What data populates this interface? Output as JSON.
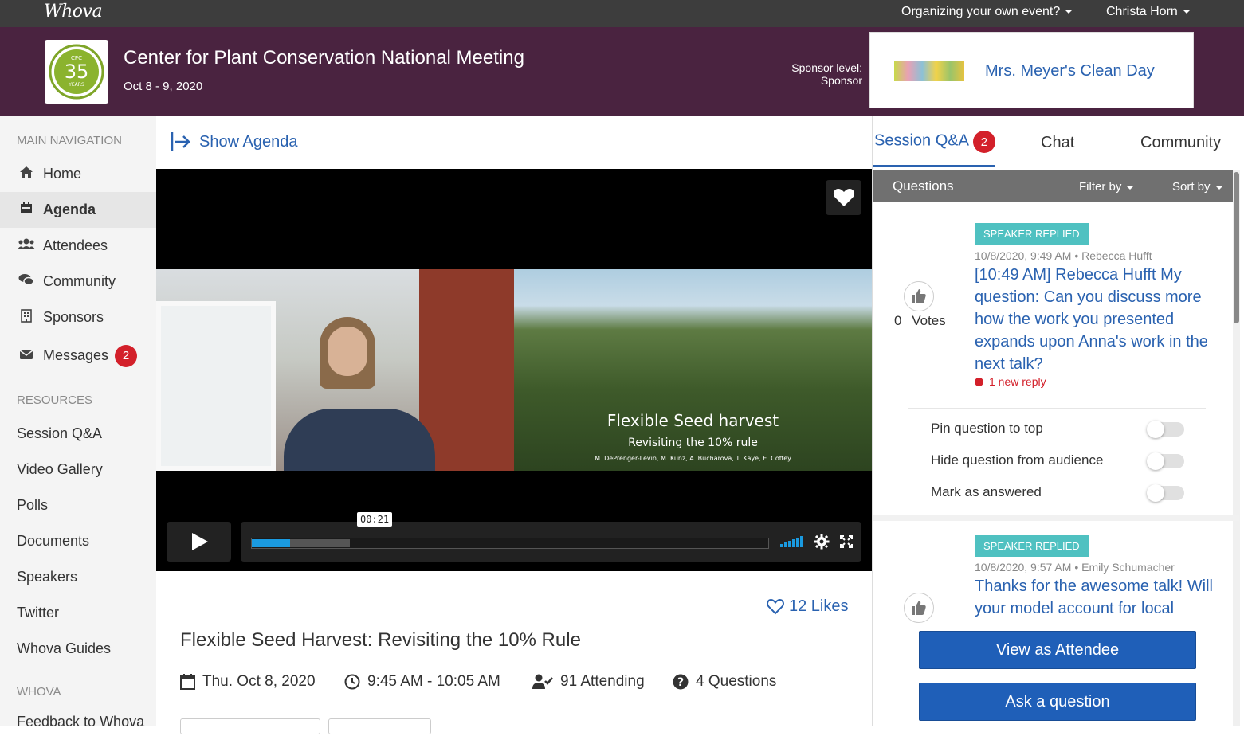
{
  "topbar": {
    "logo": "Whova",
    "organize": "Organizing your own event?",
    "user": "Christa Horn"
  },
  "event": {
    "logo_text": "CPC 35 YEARS",
    "title": "Center for Plant Conservation National Meeting",
    "dates": "Oct 8 - 9, 2020",
    "sponsor_label_line1": "Sponsor level:",
    "sponsor_label_line2": "Sponsor",
    "sponsor_name": "Mrs. Meyer's Clean Day"
  },
  "sidebar": {
    "section_main": "MAIN NAVIGATION",
    "main_items": [
      {
        "label": "Home",
        "icon": "home-icon"
      },
      {
        "label": "Agenda",
        "icon": "calendar-icon"
      },
      {
        "label": "Attendees",
        "icon": "users-icon"
      },
      {
        "label": "Community",
        "icon": "chat-bubbles-icon"
      },
      {
        "label": "Sponsors",
        "icon": "building-icon"
      },
      {
        "label": "Messages",
        "icon": "envelope-icon",
        "badge": "2"
      }
    ],
    "section_resources": "RESOURCES",
    "resource_items": [
      "Session Q&A",
      "Video Gallery",
      "Polls",
      "Documents",
      "Speakers",
      "Twitter",
      "Whova Guides"
    ],
    "section_whova": "WHOVA",
    "whova_items": [
      "Feedback to Whova"
    ]
  },
  "main": {
    "show_agenda": "Show Agenda",
    "video": {
      "slide_title": "Flexible Seed harvest",
      "slide_subtitle": "Revisiting the 10% rule",
      "slide_authors": "M. DePrenger-Levin, M. Kunz, A. Bucharova, T. Kaye, E. Coffey",
      "timecode": "00:21",
      "played_fraction": 0.074,
      "buffered_fraction": 0.19
    },
    "likes": "12 Likes",
    "session_title": "Flexible Seed Harvest: Revisiting the 10% Rule",
    "date": "Thu. Oct 8, 2020",
    "time": "9:45 AM - 10:05 AM",
    "attending": "91 Attending",
    "questions": "4 Questions"
  },
  "right": {
    "tabs": [
      {
        "label": "Session Q&A",
        "badge": "2"
      },
      {
        "label": "Chat"
      },
      {
        "label": "Community"
      }
    ],
    "questions_header": "Questions",
    "filter_by": "Filter by",
    "sort_by": "Sort by",
    "q1": {
      "tag": "SPEAKER REPLIED",
      "meta": "10/8/2020, 9:49 AM  •  Rebecca Hufft",
      "text": "[10:49 AM] Rebecca Hufft My question: Can you discuss more how the work you presented expands upon Anna's work in the next talk?",
      "votes_count": "0",
      "votes_label": "Votes",
      "new_reply": "1 new reply"
    },
    "options": [
      "Pin question to top",
      "Hide question from audience",
      "Mark as answered"
    ],
    "q2": {
      "tag": "SPEAKER REPLIED",
      "meta": "10/8/2020, 9:57 AM  •  Emily Schumacher",
      "text": "Thanks for the awesome talk! Will your model account for local"
    },
    "view_as_attendee": "View as Attendee",
    "ask_question": "Ask a question"
  },
  "colors": {
    "topbar": "#3d3d3d",
    "banner": "#4a2340",
    "link": "#2a62b0",
    "badge": "#d3202a",
    "replied_tag": "#4fc1c1",
    "primary_button": "#1f5fb8"
  }
}
